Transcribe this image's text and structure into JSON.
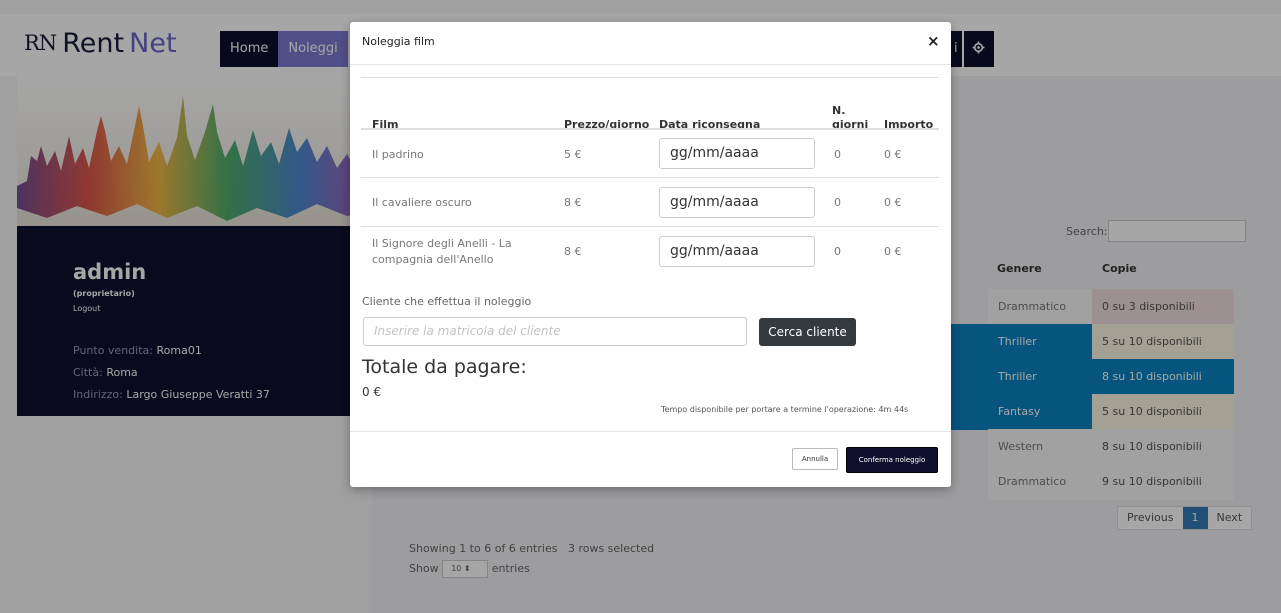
{
  "app": {
    "logo_mark": "RN",
    "name_part1": "Rent",
    "name_part2": "Net"
  },
  "nav": {
    "home_label": "Home",
    "noleggi_label": "Noleggi",
    "partial_label": "i",
    "settings_icon": "gear-icon"
  },
  "profile": {
    "name": "admin",
    "role": "(proprietario)",
    "logout": "Logout",
    "punto_vendita_label": "Punto vendita:",
    "punto_vendita": "Roma01",
    "citta_label": "Città:",
    "citta": "Roma",
    "indirizzo_label": "Indirizzo:",
    "indirizzo": "Largo Giuseppe Veratti 37"
  },
  "background_table": {
    "search_label": "Search:",
    "headers": [
      "Genere",
      "Copie"
    ],
    "rows": [
      {
        "genere": "Drammatico",
        "copie": "0 su 3 disponibili",
        "selected": false,
        "copie_color": "#f2dede"
      },
      {
        "genere": "Thriller",
        "copie": "5 su 10 disponibili",
        "selected": true,
        "copie_color": "#fcf8e3"
      },
      {
        "genere": "Thriller",
        "copie": "8 su 10 disponibili",
        "selected": true,
        "copie_color": "#0b82c4"
      },
      {
        "genere": "Fantasy",
        "copie": "5 su 10 disponibili",
        "selected": true,
        "copie_color": "#fcf8e3"
      },
      {
        "genere": "Western",
        "copie": "8 su 10 disponibili",
        "selected": false,
        "copie_color": ""
      },
      {
        "genere": "Drammatico",
        "copie": "9 su 10 disponibili",
        "selected": false,
        "copie_color": ""
      }
    ],
    "pager": {
      "previous": "Previous",
      "current": "1",
      "next": "Next"
    },
    "info": "Showing 1 to 6 of 6 entries",
    "selected_info": "3 rows selected",
    "show_label": "Show",
    "show_value": "10",
    "entries_label": "entries"
  },
  "modal": {
    "title": "Noleggia film",
    "close": "×",
    "headers": {
      "film": "Film",
      "prezzo": "Prezzo/giorno",
      "data": "Data riconsegna",
      "giorni_line1": "N.",
      "giorni_line2": "giorni",
      "importo": "Importo"
    },
    "rows": [
      {
        "film": "Il padrino",
        "prezzo": "5 €",
        "data_placeholder": "gg/mm/aaaa",
        "giorni": "0",
        "importo": "0 €"
      },
      {
        "film": "Il cavaliere oscuro",
        "prezzo": "8 €",
        "data_placeholder": "gg/mm/aaaa",
        "giorni": "0",
        "importo": "0 €"
      },
      {
        "film_line1": "Il Signore degli Anelli - La",
        "film_line2": "compagnia dell'Anello",
        "prezzo": "8 €",
        "data_placeholder": "gg/mm/aaaa",
        "giorni": "0",
        "importo": "0 €"
      }
    ],
    "cliente_label": "Cliente che effettua il noleggio",
    "cliente_placeholder": "Inserire la matricola del cliente",
    "cerca_button": "Cerca cliente",
    "totale_label": "Totale da pagare:",
    "totale_value": "0 €",
    "tempo_text": "Tempo disponibile per portare a termine l'operazione: 4m 44s",
    "annulla_button": "Annulla",
    "conferma_button": "Conferma noleggio"
  }
}
